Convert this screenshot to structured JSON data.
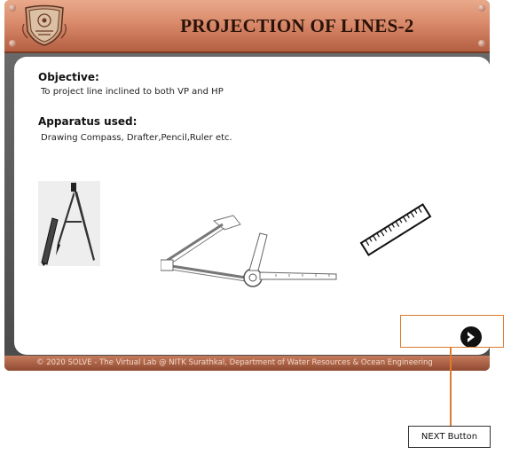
{
  "header": {
    "title": "PROJECTION OF LINES-2",
    "logo_icon": "institute-emblem-icon"
  },
  "objective": {
    "heading": "Objective:",
    "text": "To project line inclined to both VP and HP"
  },
  "apparatus": {
    "heading": "Apparatus used:",
    "text": "Drawing Compass, Drafter,Pencil,Ruler etc.",
    "images": [
      "compass-and-pencil-icon",
      "drafter-icon",
      "ruler-icon"
    ]
  },
  "footer": {
    "text": "© 2020 SOLVE - The Virtual Lab @ NITK Surathkal, Department of Water Resources & Ocean Engineering"
  },
  "next_button": {
    "icon": "chevron-right-circle-icon"
  },
  "annotation": {
    "label": "NEXT Button",
    "color": "#e07a2c"
  }
}
